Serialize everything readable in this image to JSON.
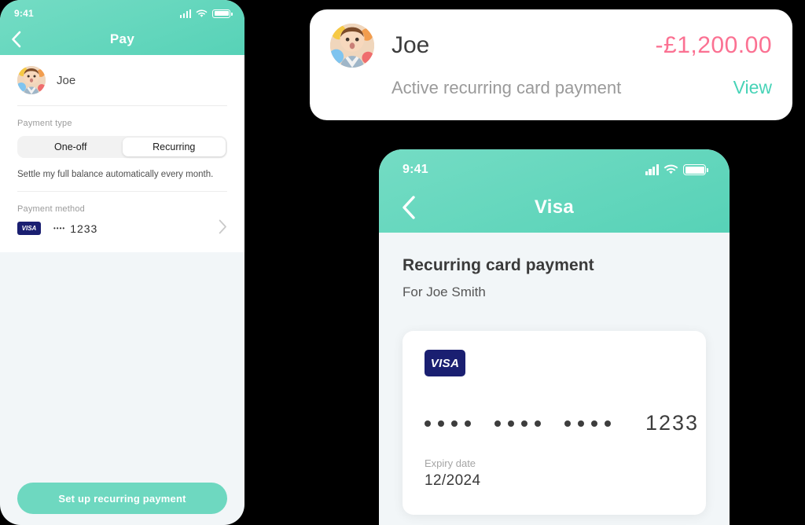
{
  "theme": {
    "teal": "#5fd6bd",
    "teal_light": "#74dcc4",
    "pink": "#fb7192",
    "visa_navy": "#1a1f71",
    "page_bg": "#000000",
    "screen_bg": "#f2f6f8"
  },
  "pay_screen": {
    "status_bar": {
      "time": "9:41",
      "signal_icon": "signal-bars-icon",
      "wifi_icon": "wifi-icon",
      "battery_icon": "battery-icon"
    },
    "nav": {
      "back_icon": "chevron-left-icon",
      "title": "Pay"
    },
    "person": {
      "avatar_icon": "avatar-child-photo",
      "name": "Joe"
    },
    "payment_type": {
      "label": "Payment type",
      "options": [
        "One-off",
        "Recurring"
      ],
      "selected": "Recurring",
      "helper": "Settle my full balance automatically every month."
    },
    "payment_method": {
      "label": "Payment method",
      "brand": "VISA",
      "masked_dots": "••••",
      "last4": "1233",
      "chevron_icon": "chevron-right-icon"
    },
    "cta": {
      "label": "Set up recurring payment"
    }
  },
  "notification": {
    "avatar_icon": "avatar-child-photo",
    "name": "Joe",
    "amount": "-£1,200.00",
    "subtitle": "Active recurring card payment",
    "action_label": "View"
  },
  "visa_screen": {
    "status_bar": {
      "time": "9:41",
      "signal_icon": "signal-bars-icon",
      "wifi_icon": "wifi-icon",
      "battery_icon": "battery-icon"
    },
    "nav": {
      "back_icon": "chevron-left-icon",
      "title": "Visa"
    },
    "heading": "Recurring card payment",
    "subheading": "For Joe Smith",
    "card": {
      "brand": "VISA",
      "group1": "••••",
      "group2": "••••",
      "group3": "••••",
      "last4": "1233",
      "expiry_label": "Expiry date",
      "expiry_value": "12/2024"
    }
  }
}
